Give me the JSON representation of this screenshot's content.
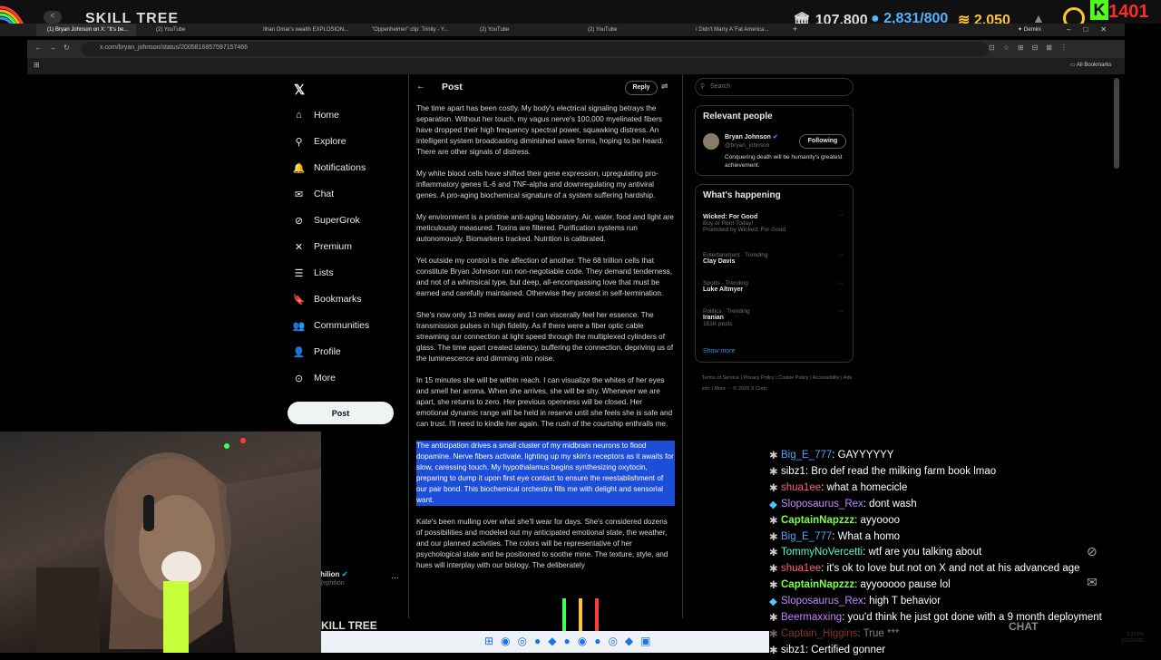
{
  "overlay": {
    "skill_tree": "SKILL TREE",
    "stat_coins": "107,800",
    "stat_exp": "2,831/800",
    "stat_gold": "2,050",
    "level": "1401",
    "kick_letter": "K"
  },
  "tabs": [
    "(1) Bryan Johnson on X: \"It's be...",
    "(2) YouTube",
    "Ilhan Omar's wealth EXPLOSION...",
    "\"Oppenheimer\" clip: Trinity - Y...",
    "(2) YouTube",
    "(2) YouTube",
    "I Didn't Marry A 'Fat America..."
  ],
  "browser": {
    "url": "x.com/bryan_johnson/status/2005816857597157466",
    "gemini": "Gemini",
    "all_bookmarks": "All Bookmarks"
  },
  "nav": {
    "items": [
      "Home",
      "Explore",
      "Notifications",
      "Chat",
      "SuperGrok",
      "Premium",
      "Lists",
      "Bookmarks",
      "Communities",
      "Profile",
      "More"
    ],
    "post_button": "Post"
  },
  "post": {
    "header_title": "Post",
    "reply_label": "Reply",
    "paragraphs": [
      "The time apart has been costly.  My body's electrical signaling betrays the separation. Without her touch, my vagus nerve's 100,000 myelinated fibers have dropped their high frequency spectral power, squawking distress. An intelligent system broadcasting diminished wave forms, hoping to be heard.  There are other signals of distress.",
      "My white blood cells have shifted their gene expression, upregulating pro-inflammatory genes IL-6 and TNF-alpha and downregulating my antiviral genes.  A pro-aging biochemical signature of a system suffering hardship.",
      "My environment is a pristine anti-aging laboratory. Air, water, food and light are meticulously measured. Toxins are filtered. Purification systems run autonomously. Biomarkers tracked. Nutrition is calibrated.",
      "Yet outside my control is the affection of another. The 68 trillion cells that constitute Bryan Johnson run non-negotiable code. They demand tenderness, and not of a whimsical type, but deep, all-encompassing love that must be earned and carefully maintained. Otherwise they protest in self-termination.",
      "She's now only 13 miles away and I can viscerally feel her essence. The transmission pulses in high fidelity. As if there were a fiber optic cable streaming our connection at light speed through the multiplexed cylinders of glass. The time apart created latency, buffering the connection, depriving us of the luminescence and dimming into noise.",
      "In 15 minutes she will be within reach. I can visualize the whites of her eyes and smell her aroma. When she arrives, she will be shy. Whenever we are apart, she returns to zero. Her previous openness will be closed. Her emotional dynamic range will be held in reserve until she feels she is safe and can trust.  I'll need to kindle her again. The rush of the courtship enthralls me.",
      "The anticipation drives a small cluster of my midbrain neurons to flood dopamine. Nerve fibers activate, lighting up my skin's receptors as it awaits for slow, caressing touch. My hypothalamus begins synthesizing oxytocin, preparing to dump it upon first eye contact to ensure the reestablishment of our pair bond. This biochemical orchestra fills me with delight and sensorial want.",
      "Kate's been mulling over what she'll wear for days.  She's considered dozens of possibilities and modeled out my anticipated emotional state, the weather, and our planned activities. The colors will be representative of her psychological state and be positioned to soothe mine. The texture, style, and hues will interplay with our biology. The deliberately"
    ]
  },
  "sidebar": {
    "search_placeholder": "Search",
    "relevant_title": "Relevant people",
    "person_name": "Bryan Johnson",
    "person_handle": "@bryan_johnson",
    "person_bio": "Conquering death will be humanity's greatest achievement.",
    "following_label": "Following",
    "happening_title": "What's happening",
    "trends": [
      {
        "context": "",
        "name": "Wicked: For Good",
        "sub": "Buy or Rent Today!",
        "promo": "Promoted by Wicked: For Good"
      },
      {
        "context": "Entertainment · Trending",
        "name": "Clay Davis",
        "sub": "",
        "promo": ""
      },
      {
        "context": "Sports · Trending",
        "name": "Luke Altmyer",
        "sub": "",
        "promo": ""
      },
      {
        "context": "Politics · Trending",
        "name": "Iranian",
        "sub": "151K posts",
        "promo": ""
      }
    ],
    "show_more": "Show more",
    "footer": "Terms of Service  |  Privacy Policy  |  Cookie Policy  |  Accessibility  |  Ads info  |  More ···  © 2025 X Corp."
  },
  "account": {
    "name": "rhilion",
    "handle": "@rphilion"
  },
  "chat": [
    {
      "user": "Big_E_777",
      "color": "#4fa3ff",
      "msg": "GAYYYYYY"
    },
    {
      "user": "sibz1",
      "color": "#ffffff",
      "msg": "Bro def read the milking farm book lmao"
    },
    {
      "user": "shua1ee",
      "color": "#ff5f7e",
      "msg": "what a homecicle"
    },
    {
      "user": "Sloposaurus_Rex",
      "color": "#c08bff",
      "msg": "dont wash"
    },
    {
      "user": "CaptainNapzzz",
      "color": "#7dff4a",
      "msg": "ayyoooo"
    },
    {
      "user": "Big_E_777",
      "color": "#4fa3ff",
      "msg": "What a homo"
    },
    {
      "user": "TommyNoVercetti",
      "color": "#4affd2",
      "msg": "wtf are you talking about"
    },
    {
      "user": "shua1ee",
      "color": "#ff5f7e",
      "msg": "it's ok to love but not on X and not at his advanced age"
    },
    {
      "user": "CaptainNapzzz",
      "color": "#7dff4a",
      "msg": "ayyooooo pause lol"
    },
    {
      "user": "Sloposaurus_Rex",
      "color": "#c08bff",
      "msg": "high T behavior"
    },
    {
      "user": "Beermaxxing",
      "color": "#c87dff",
      "msg": "you'd think he just got done with a 9 month deployment"
    },
    {
      "user": "Captain_Higgins",
      "color": "#ff6a6a",
      "msg": "True ***"
    },
    {
      "user": "sibz1",
      "color": "#ffffff",
      "msg": "Certified gonner"
    }
  ],
  "stream": {
    "bottom_label": "KILL TREE",
    "chat_label": "CHAT"
  },
  "clock": {
    "time": "5:22 PM",
    "date": "12/30/2025"
  }
}
